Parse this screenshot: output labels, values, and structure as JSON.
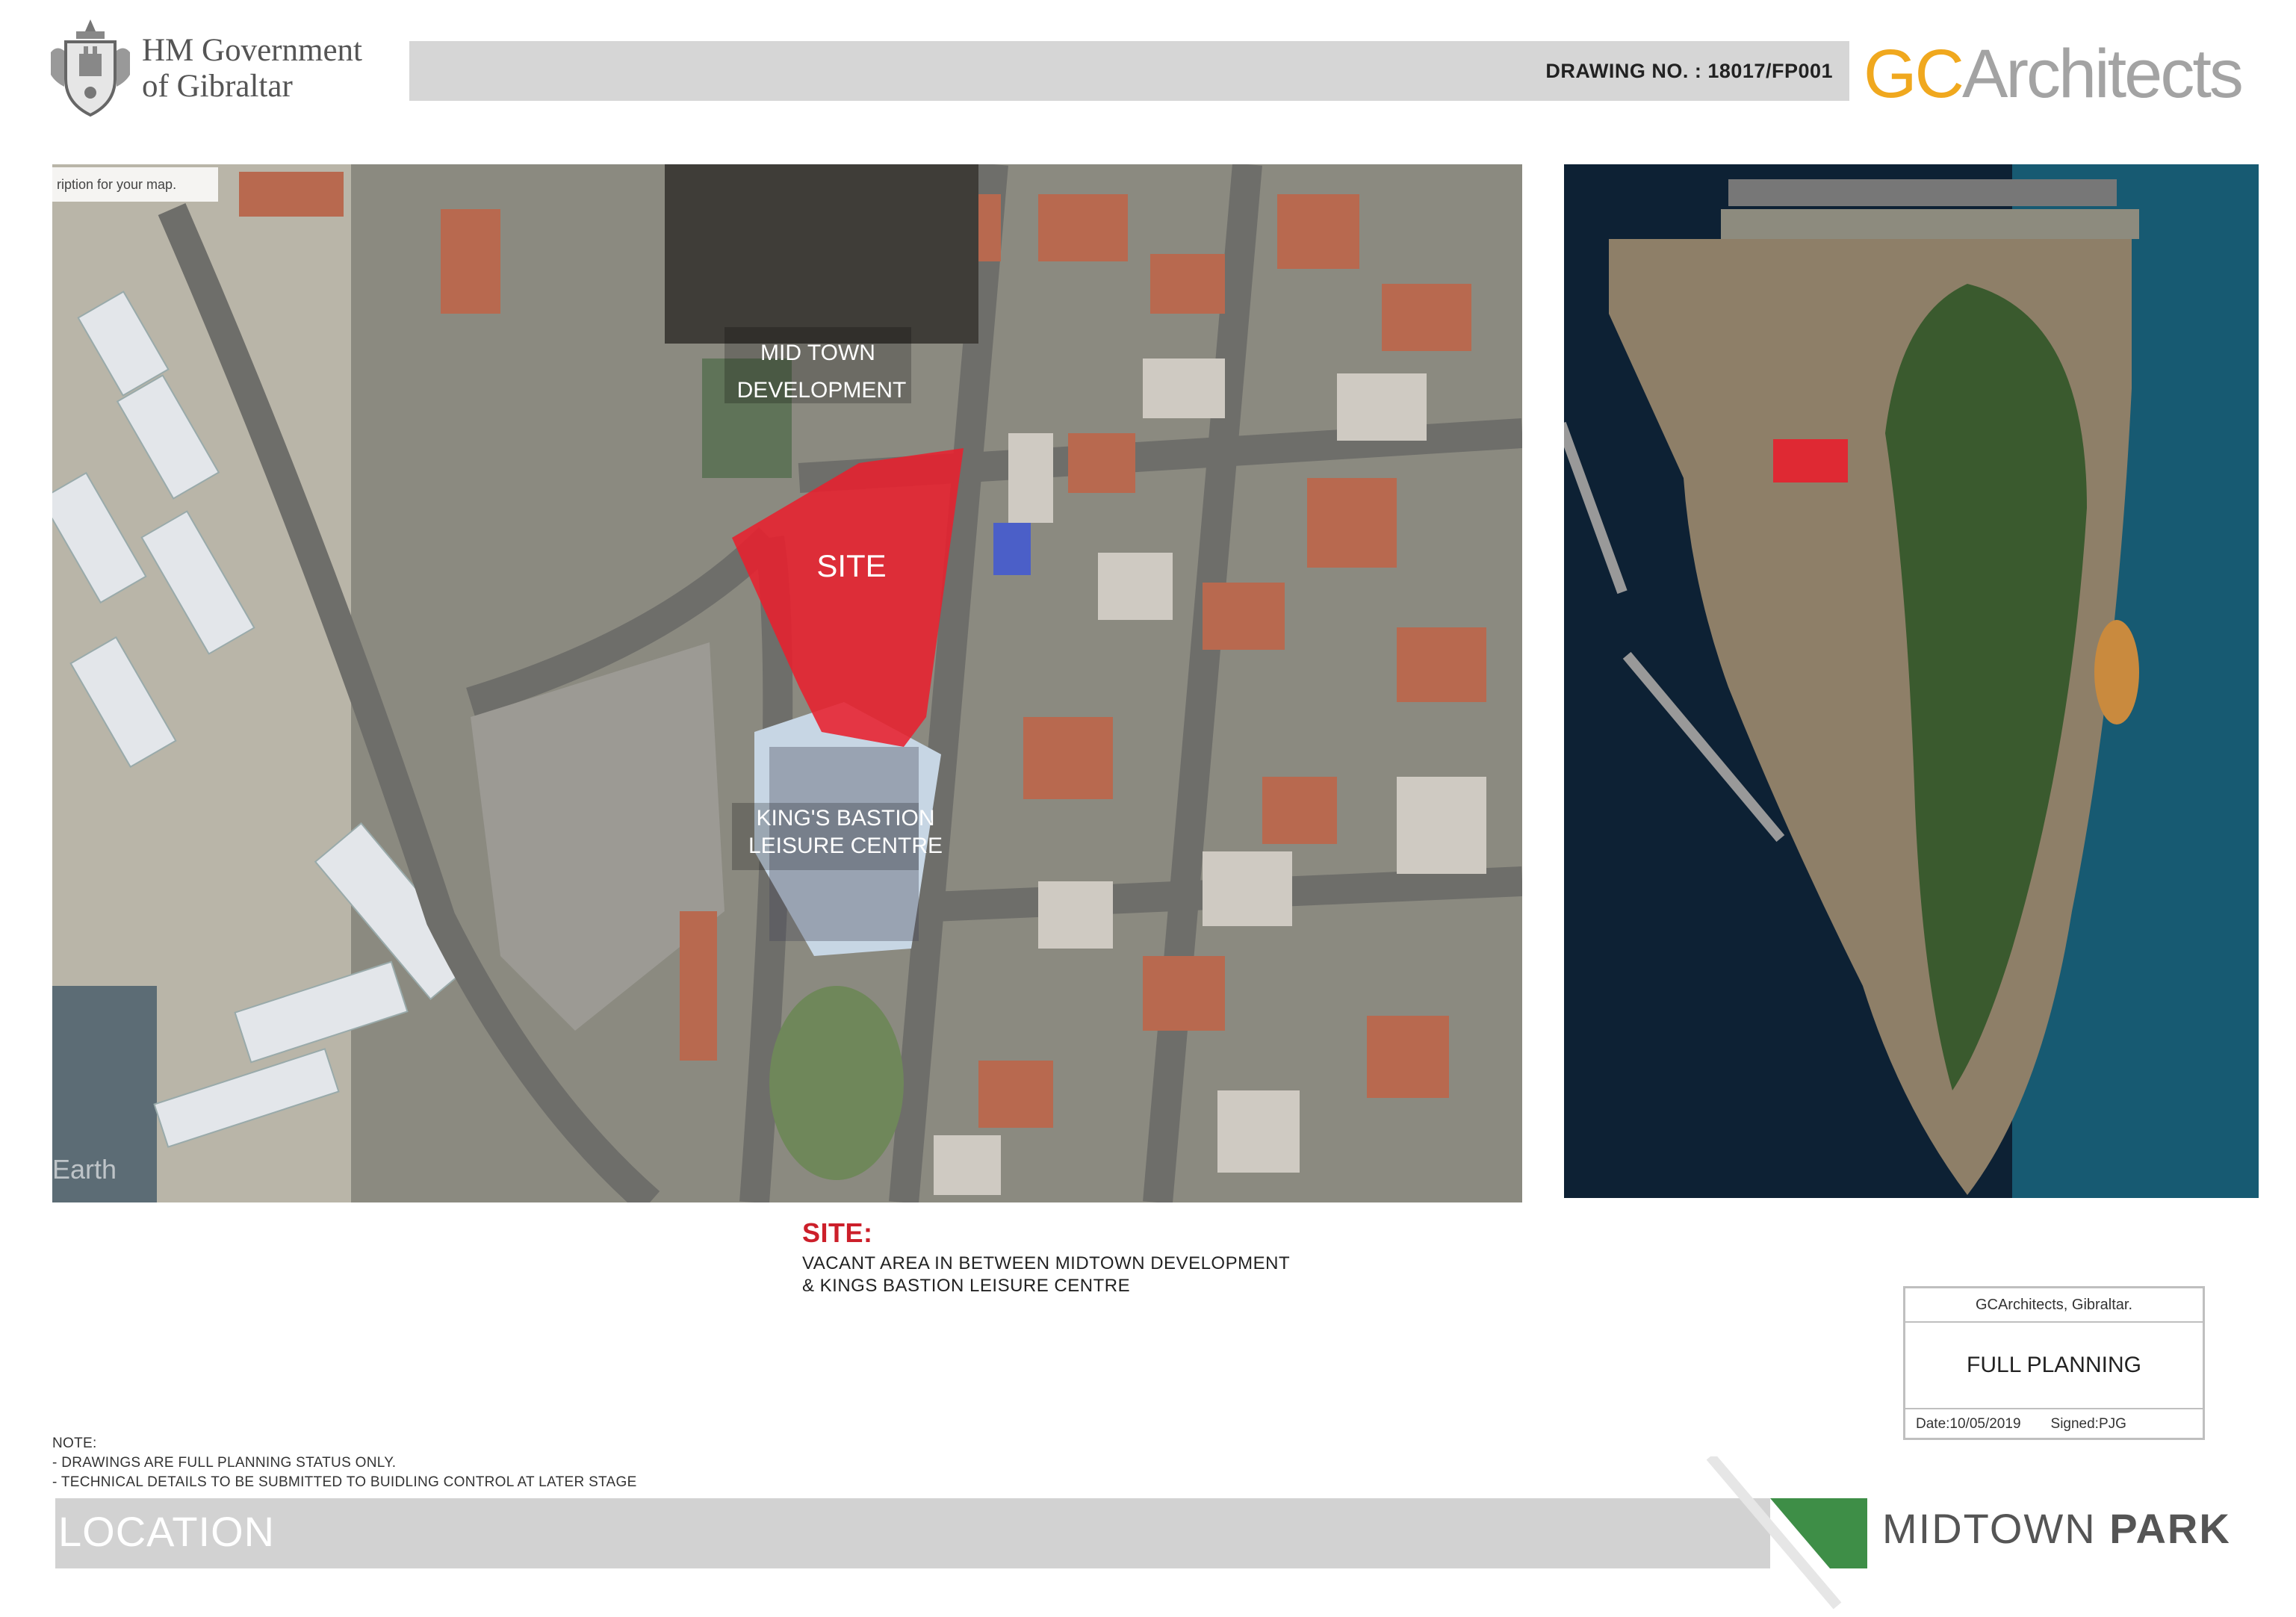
{
  "header": {
    "org_line1": "HM Government",
    "org_line2": "of Gibraltar",
    "drawing_no": "DRAWING NO. : 18017/FP001",
    "logo_part1": "GC",
    "logo_part2": "Architects",
    "crest_icon": "coat-of-arms-icon"
  },
  "main_map": {
    "subscription_text": "ription for your map.",
    "watermark": "Earth",
    "labels": {
      "midtown_line1": "MID TOWN",
      "midtown_line2": "DEVELOPMENT",
      "site": "SITE",
      "kings_line1": "KING'S BASTION",
      "kings_line2": "LEISURE CENTRE"
    },
    "site_color": "#e8202e"
  },
  "site_caption": {
    "title": "SITE:",
    "line1": "VACANT AREA IN BETWEEN MIDTOWN DEVELOPMENT",
    "line2": "& KINGS BASTION LEISURE CENTRE"
  },
  "title_block": {
    "firm": "GCArchitects, Gibraltar.",
    "status": "FULL PLANNING",
    "date": "Date:10/05/2019",
    "signed": "Signed:PJG"
  },
  "notes": {
    "heading": "NOTE:",
    "line1": "- DRAWINGS ARE FULL PLANNING STATUS ONLY.",
    "line2": "- TECHNICAL DETAILS TO BE SUBMITTED TO BUIDLING CONTROL AT LATER STAGE"
  },
  "footer": {
    "title": "LOCATION",
    "project_part1": "MIDTOWN ",
    "project_part2": "PARK",
    "accent_color": "#3e8e47"
  }
}
